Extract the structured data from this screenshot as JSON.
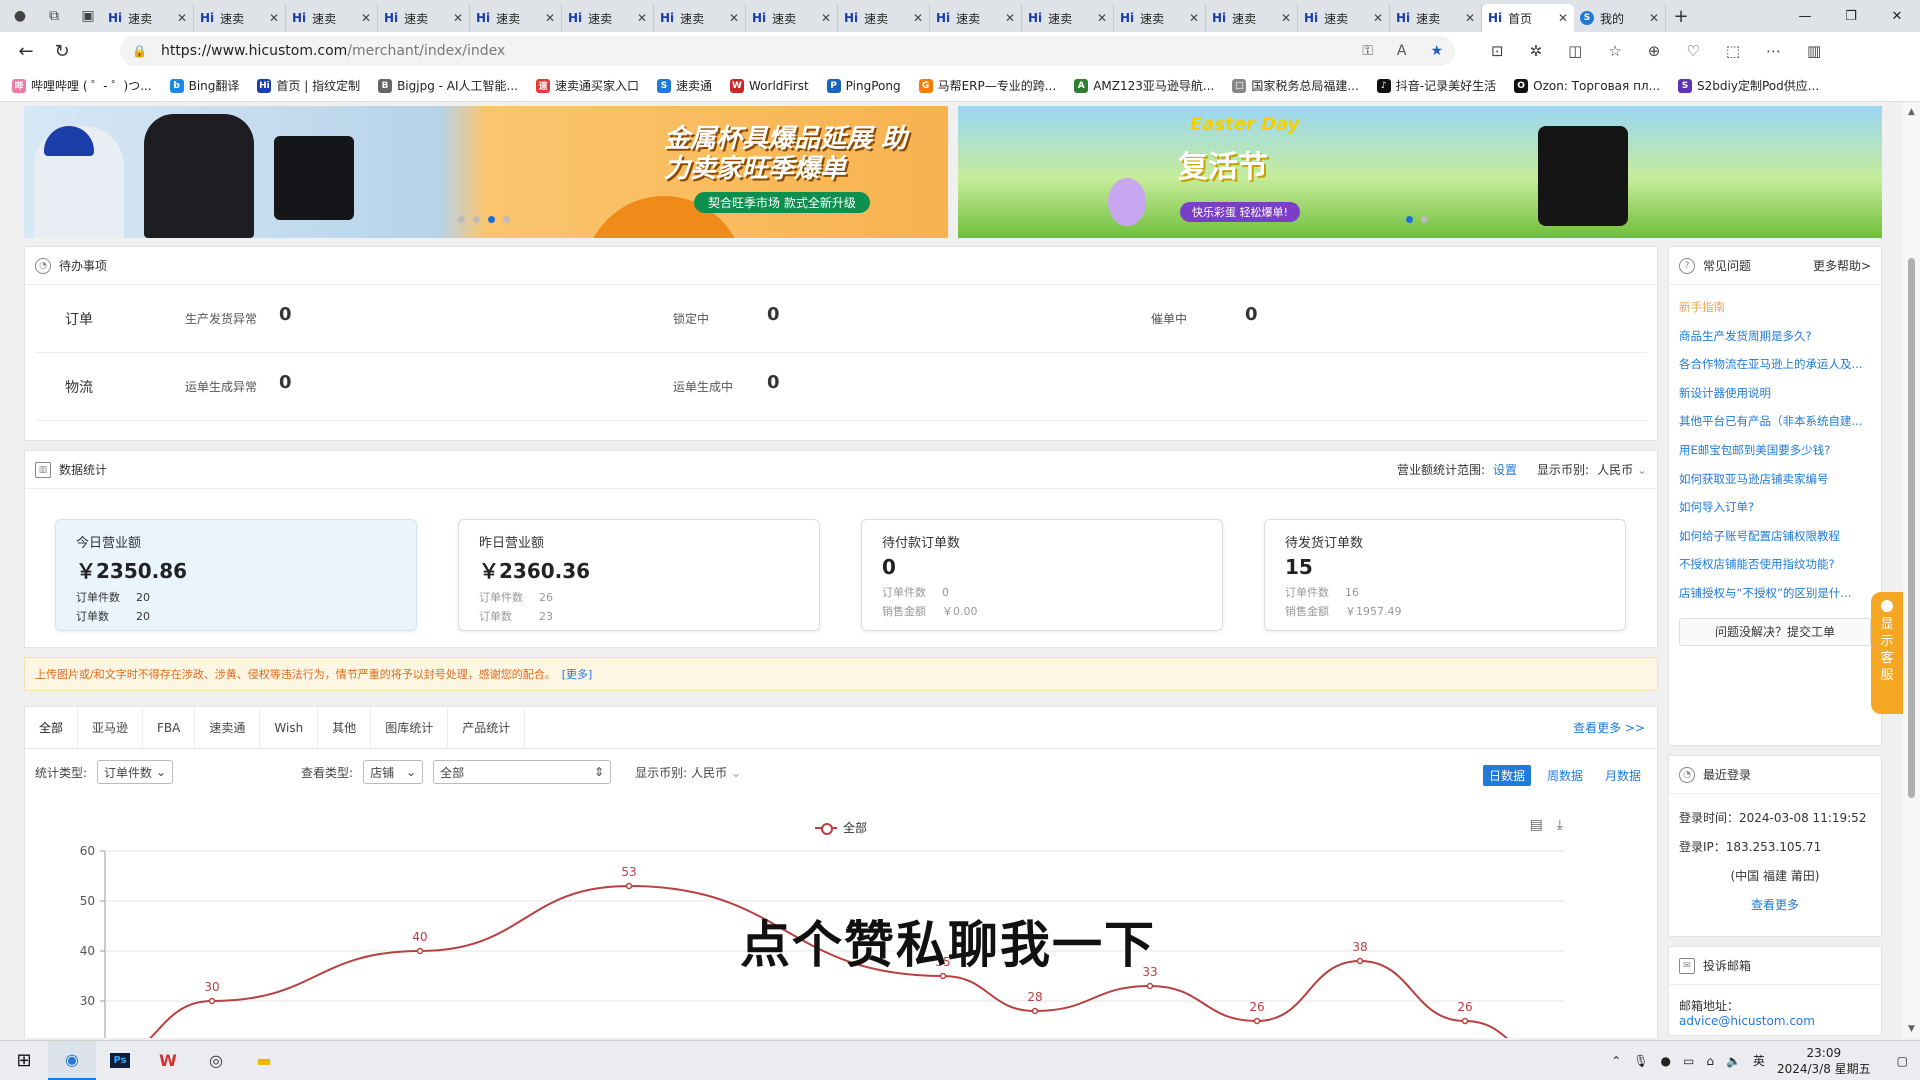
{
  "browser": {
    "tabs": [
      {
        "icon": "Hi",
        "label": "速卖"
      },
      {
        "icon": "Hi",
        "label": "速卖"
      },
      {
        "icon": "Hi",
        "label": "速卖"
      },
      {
        "icon": "Hi",
        "label": "速卖"
      },
      {
        "icon": "Hi",
        "label": "速卖"
      },
      {
        "icon": "Hi",
        "label": "速卖"
      },
      {
        "icon": "Hi",
        "label": "速卖"
      },
      {
        "icon": "Hi",
        "label": "速卖"
      },
      {
        "icon": "Hi",
        "label": "速卖"
      },
      {
        "icon": "Hi",
        "label": "速卖"
      },
      {
        "icon": "Hi",
        "label": "速卖"
      },
      {
        "icon": "Hi",
        "label": "速卖"
      },
      {
        "icon": "Hi",
        "label": "速卖"
      },
      {
        "icon": "Hi",
        "label": "速卖"
      },
      {
        "icon": "Hi",
        "label": "速卖"
      },
      {
        "icon": "Hi",
        "label": "首页"
      },
      {
        "icon": "S",
        "label": "我的"
      }
    ],
    "url_host": "https://www.hicustom.com",
    "url_path": "/merchant/index/index",
    "bookmarks": [
      {
        "icon": "哔",
        "color": "#f07aa0",
        "label": "哔哩哔哩 ( ゜- ゜)つ..."
      },
      {
        "icon": "b",
        "color": "#1e88e5",
        "label": "Bing翻译"
      },
      {
        "icon": "Hi",
        "color": "#1a3fa8",
        "label": "首页 | 指纹定制"
      },
      {
        "icon": "B",
        "color": "#666666",
        "label": "Bigjpg - AI人工智能..."
      },
      {
        "icon": "速",
        "color": "#e53935",
        "label": "速卖通买家入口"
      },
      {
        "icon": "S",
        "color": "#1f7ad9",
        "label": "速卖通"
      },
      {
        "icon": "W",
        "color": "#c62828",
        "label": "WorldFirst"
      },
      {
        "icon": "P",
        "color": "#1565c0",
        "label": "PingPong"
      },
      {
        "icon": "G",
        "color": "#f57c00",
        "label": "马帮ERP—专业的跨..."
      },
      {
        "icon": "A",
        "color": "#2e7d32",
        "label": "AMZ123亚马逊导航..."
      },
      {
        "icon": "□",
        "color": "#888888",
        "label": "国家税务总局福建..."
      },
      {
        "icon": "♪",
        "color": "#111111",
        "label": "抖音-记录美好生活"
      },
      {
        "icon": "O",
        "color": "#111111",
        "label": "Ozon: Торговая пл..."
      },
      {
        "icon": "S",
        "color": "#5e35b1",
        "label": "S2bdiy定制Pod供应..."
      }
    ]
  },
  "banners": {
    "left_text": "金属杯具爆品延展 助力卖家旺季爆单",
    "left_sub": "契合旺季市场 款式全新升级",
    "right_text": "复活节",
    "right_en": "Easter Day",
    "right_sub": "快乐彩蛋 轻松爆单!"
  },
  "todo": {
    "title": "待办事项",
    "rows": [
      {
        "category": "订单",
        "items": [
          {
            "label": "生产发货异常",
            "value": "0"
          },
          {
            "label": "锁定中",
            "value": "0"
          },
          {
            "label": "催单中",
            "value": "0"
          }
        ]
      },
      {
        "category": "物流",
        "items": [
          {
            "label": "运单生成异常",
            "value": "0"
          },
          {
            "label": "运单生成中",
            "value": "0"
          }
        ]
      }
    ]
  },
  "stats": {
    "title": "数据统计",
    "range_label": "营业额统计范围:",
    "range_link": "设置",
    "currency_label": "显示币别:",
    "currency_value": "人民币",
    "cards": [
      {
        "title": "今日营业额",
        "value": "￥2350.86",
        "l1": "订单件数",
        "v1": "20",
        "l2": "订单数",
        "v2": "20"
      },
      {
        "title": "昨日营业额",
        "value": "￥2360.36",
        "l1": "订单件数",
        "v1": "26",
        "l2": "订单数",
        "v2": "23"
      },
      {
        "title": "待付款订单数",
        "value": "0",
        "l1": "订单件数",
        "v1": "0",
        "l2": "销售金额",
        "v2": "￥0.00"
      },
      {
        "title": "待发货订单数",
        "value": "15",
        "l1": "订单件数",
        "v1": "16",
        "l2": "销售金额",
        "v2": "￥1957.49"
      }
    ]
  },
  "notice": {
    "text": "上传图片或/和文字时不得存在涉政、涉黄、侵权等违法行为，情节严重的将予以封号处理，感谢您的配合。",
    "more": "[更多]"
  },
  "chart_panel": {
    "tabs": [
      "全部",
      "亚马逊",
      "FBA",
      "速卖通",
      "Wish",
      "其他",
      "图库统计",
      "产品统计"
    ],
    "view_more": "查看更多 >>",
    "stat_type_label": "统计类型:",
    "stat_type_value": "订单件数",
    "view_type_label": "查看类型:",
    "view_type_value": "店铺",
    "scope_value": "全部",
    "currency_label": "显示币别:",
    "currency_value": "人民币",
    "periods": [
      "日数据",
      "周数据",
      "月数据"
    ]
  },
  "chart_data": {
    "type": "line",
    "series": [
      {
        "name": "全部",
        "color": "#b8403f"
      }
    ],
    "points": [
      {
        "x": 1,
        "y": 30,
        "label": "30"
      },
      {
        "x": 2,
        "y": 40,
        "label": "40"
      },
      {
        "x": 3,
        "y": 53,
        "label": "53"
      },
      {
        "x": 4,
        "y": 35,
        "label": "35"
      },
      {
        "x": 5,
        "y": 28,
        "label": "28"
      },
      {
        "x": 6,
        "y": 33,
        "label": "33"
      },
      {
        "x": 7,
        "y": 26,
        "label": "26"
      },
      {
        "x": 8,
        "y": 38,
        "label": "38"
      },
      {
        "x": 9,
        "y": 26,
        "label": "26"
      }
    ],
    "yticks": [
      30,
      40,
      50,
      60
    ],
    "ylim": [
      20,
      60
    ],
    "grid": true,
    "legend": "top-center"
  },
  "overlay_caption": "点个赞私聊我一下",
  "faq": {
    "title": "常见问题",
    "more": "更多帮助>",
    "items": [
      "新手指南",
      "商品生产发货周期是多久?",
      "各合作物流在亚马逊上的承运人及...",
      "新设计器使用说明",
      "其他平台已有产品（非本系统自建...",
      "用E邮宝包邮到美国要多少钱?",
      "如何获取亚马逊店铺卖家编号",
      "如何导入订单?",
      "如何给子账号配置店铺权限教程",
      "不授权店铺能否使用指纹功能?",
      "店铺授权与“不授权”的区别是什..."
    ],
    "button": "问题没解决？提交工单"
  },
  "customer_service": "显示客服",
  "login": {
    "title": "最近登录",
    "time": "登录时间：2024-03-08 11:19:52",
    "ip": "登录IP：183.253.105.71",
    "location": "(中国 福建 莆田)",
    "more": "查看更多"
  },
  "mail": {
    "title": "投诉邮箱",
    "label": "邮箱地址：",
    "email": "advice@hicustom.com"
  },
  "taskbar": {
    "lang": "英",
    "time": "23:09",
    "date": "2024/3/8 星期五"
  }
}
